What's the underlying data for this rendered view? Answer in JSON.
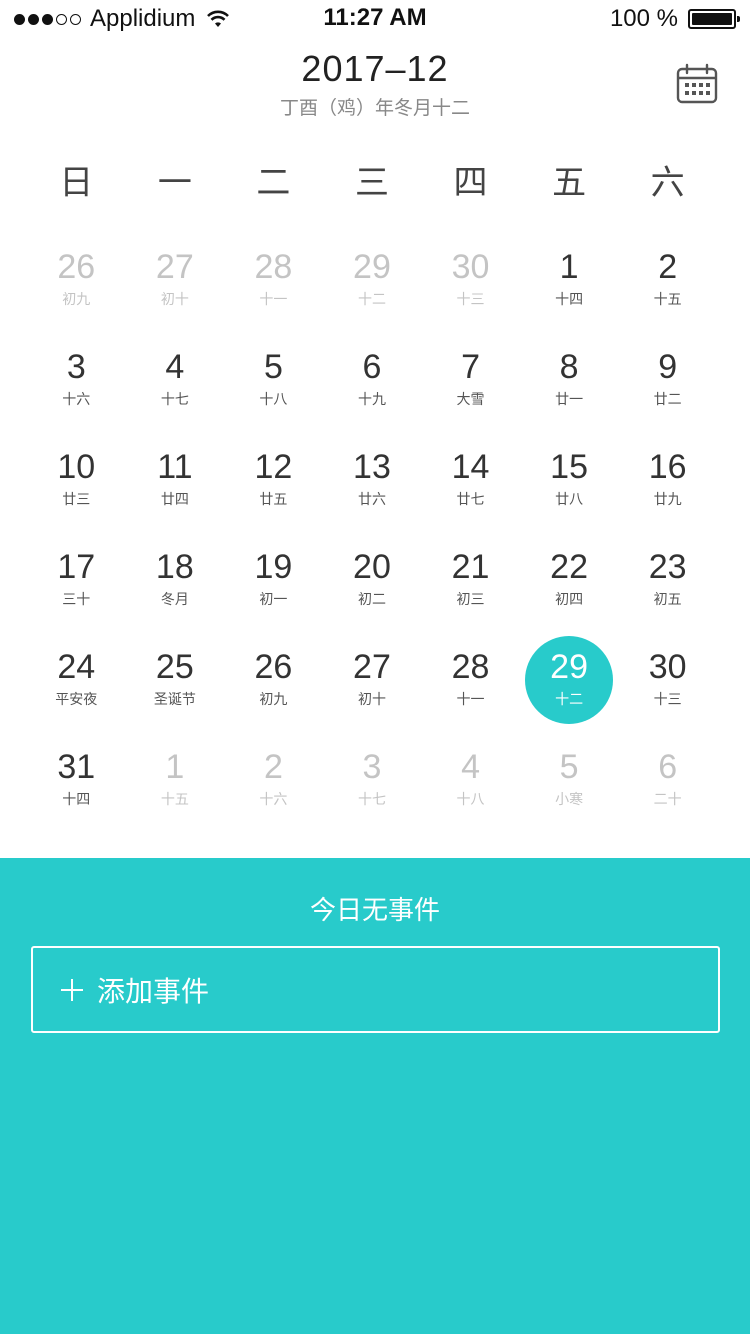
{
  "colors": {
    "accent": "#28CBCB",
    "faded_text": "#C4C4C4"
  },
  "status_bar": {
    "signal_filled": 3,
    "signal_total": 5,
    "carrier": "Applidium",
    "time": "11:27 AM",
    "battery": "100 %",
    "battery_level": 1.0
  },
  "header": {
    "title": "2017–12",
    "subtitle": "丁酉（鸡）年冬月十二",
    "calendar_icon": "calendar-icon"
  },
  "weekdays": [
    "日",
    "一",
    "二",
    "三",
    "四",
    "五",
    "六"
  ],
  "days": [
    {
      "day": "26",
      "lunar": "初九",
      "faded": true
    },
    {
      "day": "27",
      "lunar": "初十",
      "faded": true
    },
    {
      "day": "28",
      "lunar": "十一",
      "faded": true
    },
    {
      "day": "29",
      "lunar": "十二",
      "faded": true
    },
    {
      "day": "30",
      "lunar": "十三",
      "faded": true
    },
    {
      "day": "1",
      "lunar": "十四"
    },
    {
      "day": "2",
      "lunar": "十五"
    },
    {
      "day": "3",
      "lunar": "十六"
    },
    {
      "day": "4",
      "lunar": "十七"
    },
    {
      "day": "5",
      "lunar": "十八"
    },
    {
      "day": "6",
      "lunar": "十九"
    },
    {
      "day": "7",
      "lunar": "大雪"
    },
    {
      "day": "8",
      "lunar": "廿一"
    },
    {
      "day": "9",
      "lunar": "廿二"
    },
    {
      "day": "10",
      "lunar": "廿三"
    },
    {
      "day": "11",
      "lunar": "廿四"
    },
    {
      "day": "12",
      "lunar": "廿五"
    },
    {
      "day": "13",
      "lunar": "廿六"
    },
    {
      "day": "14",
      "lunar": "廿七"
    },
    {
      "day": "15",
      "lunar": "廿八"
    },
    {
      "day": "16",
      "lunar": "廿九"
    },
    {
      "day": "17",
      "lunar": "三十"
    },
    {
      "day": "18",
      "lunar": "冬月"
    },
    {
      "day": "19",
      "lunar": "初一"
    },
    {
      "day": "20",
      "lunar": "初二"
    },
    {
      "day": "21",
      "lunar": "初三"
    },
    {
      "day": "22",
      "lunar": "初四"
    },
    {
      "day": "23",
      "lunar": "初五"
    },
    {
      "day": "24",
      "lunar": "平安夜"
    },
    {
      "day": "25",
      "lunar": "圣诞节"
    },
    {
      "day": "26",
      "lunar": "初九"
    },
    {
      "day": "27",
      "lunar": "初十"
    },
    {
      "day": "28",
      "lunar": "十一"
    },
    {
      "day": "29",
      "lunar": "十二",
      "selected": true
    },
    {
      "day": "30",
      "lunar": "十三"
    },
    {
      "day": "31",
      "lunar": "十四"
    },
    {
      "day": "1",
      "lunar": "十五",
      "faded": true
    },
    {
      "day": "2",
      "lunar": "十六",
      "faded": true
    },
    {
      "day": "3",
      "lunar": "十七",
      "faded": true
    },
    {
      "day": "4",
      "lunar": "十八",
      "faded": true
    },
    {
      "day": "5",
      "lunar": "小寒",
      "faded": true
    },
    {
      "day": "6",
      "lunar": "二十",
      "faded": true
    }
  ],
  "events": {
    "empty_message": "今日无事件",
    "add_label": "添加事件",
    "add_icon": "plus-icon"
  }
}
